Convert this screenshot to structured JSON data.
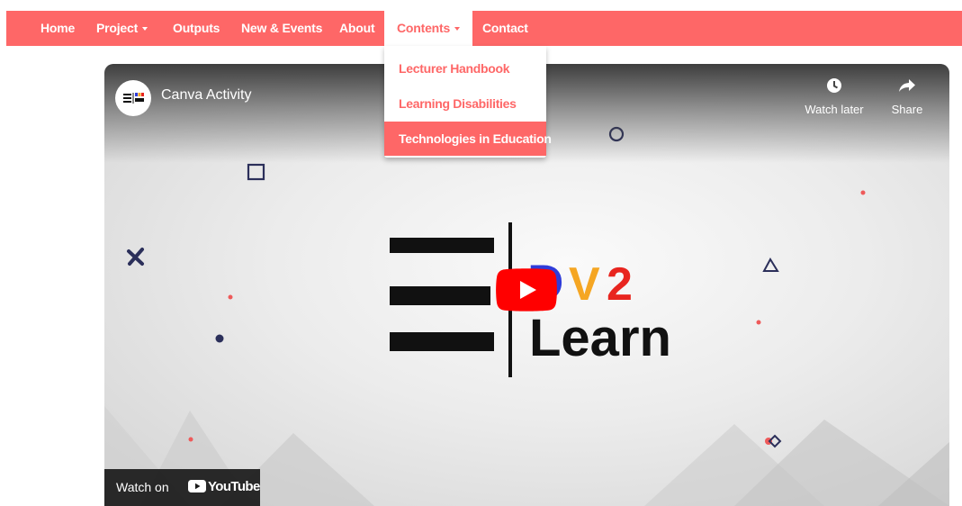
{
  "nav": {
    "items": [
      {
        "label": "Home"
      },
      {
        "label": "Project"
      },
      {
        "label": "Outputs"
      },
      {
        "label": "New & Events"
      },
      {
        "label": "About"
      },
      {
        "label": "Contents"
      },
      {
        "label": "Contact"
      }
    ],
    "active": "Contents"
  },
  "dropdown": {
    "items": [
      {
        "label": "Lecturer Handbook"
      },
      {
        "label": "Learning Disabilities"
      },
      {
        "label": "Technologies in Education"
      }
    ],
    "highlighted": "Technologies in Education"
  },
  "video": {
    "title": "Canva Activity",
    "watch_later": "Watch later",
    "share": "Share",
    "watch_on": "Watch on",
    "youtube": "YouTube",
    "logo_letters": "DV2",
    "logo_word": "Learn",
    "avatar_text": "DV2 Learn"
  },
  "colors": {
    "brand": "#fe6767",
    "youtube_red": "#ff0000",
    "logo_blue": "#2f3cd9",
    "logo_orange": "#f5a623",
    "logo_red": "#e8251f",
    "shape_navy": "#2b2f5a"
  }
}
